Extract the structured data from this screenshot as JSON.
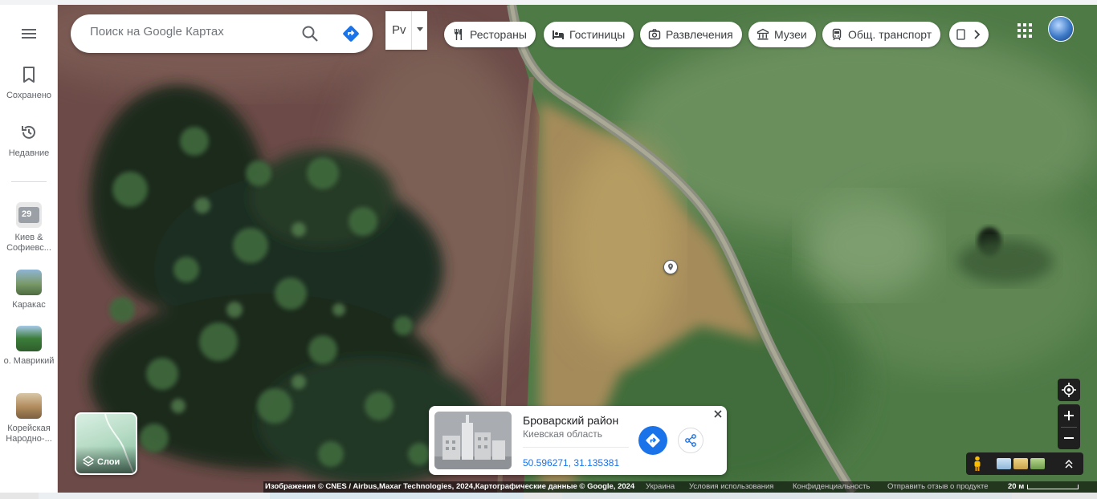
{
  "search": {
    "placeholder": "Поиск на Google Картах"
  },
  "lang": {
    "label": "Рv"
  },
  "rail": {
    "saved": "Сохранено",
    "recent": "Недавние",
    "recents": [
      {
        "label": "Киев & Софиевс...",
        "badge": "29"
      },
      {
        "label": "Каракас"
      },
      {
        "label": "о. Маврикий"
      },
      {
        "label": "Корейская Народно-..."
      }
    ]
  },
  "chips": {
    "restaurants": "Рестораны",
    "hotels": "Гостиницы",
    "entertainment": "Развлечения",
    "museums": "Музеи",
    "transit": "Общ. транспорт"
  },
  "layers": {
    "label": "Слои"
  },
  "card": {
    "title": "Броварский район",
    "subtitle": "Киевская область",
    "coords": "50.596271, 31.135381"
  },
  "footer": {
    "attribution": "Изображения © CNES / Airbus,Maxar Technologies, 2024,Картографические данные © Google, 2024",
    "country": "Украина",
    "terms": "Условия использования",
    "privacy": "Конфиденциальность",
    "feedback": "Отправить отзыв о продукте",
    "scale": "20 м"
  },
  "colors": {
    "accent": "#1a73e8",
    "controls": "#1f1f1f"
  }
}
